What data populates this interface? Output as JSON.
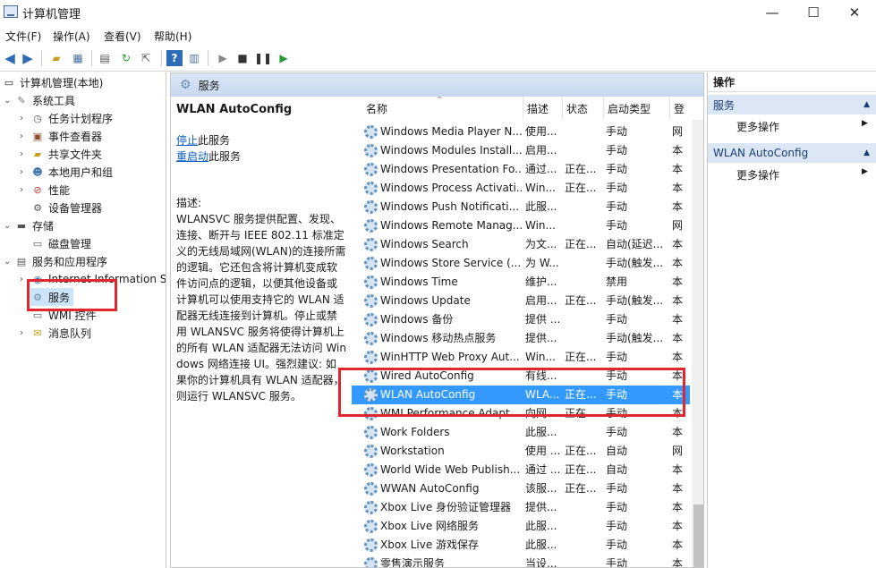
{
  "window": {
    "title": "计算机管理",
    "min": "—",
    "max": "☐",
    "close": "✕"
  },
  "menu": [
    "文件(F)",
    "操作(A)",
    "查看(V)",
    "帮助(H)"
  ],
  "tree": [
    {
      "label": "计算机管理(本地)",
      "icon": "computer-icon"
    },
    {
      "label": "系统工具",
      "icon": "tools-icon"
    },
    {
      "label": "任务计划程序",
      "icon": "clock-icon"
    },
    {
      "label": "事件查看器",
      "icon": "event-viewer-icon"
    },
    {
      "label": "共享文件夹",
      "icon": "shared-folder-icon"
    },
    {
      "label": "本地用户和组",
      "icon": "users-icon"
    },
    {
      "label": "性能",
      "icon": "performance-icon"
    },
    {
      "label": "设备管理器",
      "icon": "device-manager-icon"
    },
    {
      "label": "存储",
      "icon": "storage-icon"
    },
    {
      "label": "磁盘管理",
      "icon": "disk-icon"
    },
    {
      "label": "服务和应用程序",
      "icon": "services-apps-icon"
    },
    {
      "label": "Internet Information S",
      "icon": "iis-icon"
    },
    {
      "label": "服务",
      "icon": "gear-icon"
    },
    {
      "label": "WMI 控件",
      "icon": "wmi-icon"
    },
    {
      "label": "消息队列",
      "icon": "message-queue-icon"
    }
  ],
  "services_header": "服务",
  "detail": {
    "name": "WLAN AutoConfig",
    "stop_link": "停止",
    "stop_suffix": "此服务",
    "restart_link": "重启动",
    "restart_suffix": "此服务",
    "desc_label": "描述:",
    "desc_text": "WLANSVC 服务提供配置、发现、连接、断开与 IEEE 802.11 标准定义的无线局域网(WLAN)的连接所需的逻辑。它还包含将计算机变成软件访问点的逻辑，以便其他设备或计算机可以使用支持它的 WLAN 适配器无线连接到计算机。停止或禁用 WLANSVC 服务将使得计算机上的所有 WLAN 适配器无法访问 Windows 网络连接 UI。强烈建议: 如果你的计算机具有 WLAN 适配器，则运行 WLANSVC 服务。"
  },
  "columns": {
    "name": "名称",
    "desc": "描述",
    "status": "状态",
    "startup": "启动类型",
    "logon": "登"
  },
  "services": [
    {
      "name": "Windows Media Player N...",
      "desc": "使用...",
      "status": "",
      "startup": "手动",
      "logon": "网"
    },
    {
      "name": "Windows Modules Install...",
      "desc": "启用...",
      "status": "",
      "startup": "手动",
      "logon": "本"
    },
    {
      "name": "Windows Presentation Fo...",
      "desc": "通过...",
      "status": "正在...",
      "startup": "手动",
      "logon": "本"
    },
    {
      "name": "Windows Process Activati...",
      "desc": "Win...",
      "status": "正在...",
      "startup": "手动",
      "logon": "本"
    },
    {
      "name": "Windows Push Notificati...",
      "desc": "此服...",
      "status": "",
      "startup": "手动",
      "logon": "本"
    },
    {
      "name": "Windows Remote Manag...",
      "desc": "Win...",
      "status": "",
      "startup": "手动",
      "logon": "网"
    },
    {
      "name": "Windows Search",
      "desc": "为文...",
      "status": "正在...",
      "startup": "自动(延迟...",
      "logon": "本"
    },
    {
      "name": "Windows Store Service (...",
      "desc": "为 W...",
      "status": "",
      "startup": "手动(触发...",
      "logon": "本"
    },
    {
      "name": "Windows Time",
      "desc": "维护...",
      "status": "",
      "startup": "禁用",
      "logon": "本"
    },
    {
      "name": "Windows Update",
      "desc": "启用...",
      "status": "正在...",
      "startup": "手动(触发...",
      "logon": "本"
    },
    {
      "name": "Windows 备份",
      "desc": "提供 ...",
      "status": "",
      "startup": "手动",
      "logon": "本"
    },
    {
      "name": "Windows 移动热点服务",
      "desc": "提供...",
      "status": "",
      "startup": "手动(触发...",
      "logon": "本"
    },
    {
      "name": "WinHTTP Web Proxy Aut...",
      "desc": "Win...",
      "status": "正在...",
      "startup": "手动",
      "logon": "本"
    },
    {
      "name": "Wired AutoConfig",
      "desc": "有线...",
      "status": "",
      "startup": "手动",
      "logon": "本"
    },
    {
      "name": "WLAN AutoConfig",
      "desc": "WLA...",
      "status": "正在...",
      "startup": "手动",
      "logon": "本"
    },
    {
      "name": "WMI Performance Adapt...",
      "desc": "向网...",
      "status": "正在...",
      "startup": "手动",
      "logon": "本"
    },
    {
      "name": "Work Folders",
      "desc": "此服...",
      "status": "",
      "startup": "手动",
      "logon": "本"
    },
    {
      "name": "Workstation",
      "desc": "使用 ...",
      "status": "正在...",
      "startup": "自动",
      "logon": "网"
    },
    {
      "name": "World Wide Web Publish...",
      "desc": "通过 ...",
      "status": "正在...",
      "startup": "自动",
      "logon": "本"
    },
    {
      "name": "WWAN AutoConfig",
      "desc": "该服...",
      "status": "正在...",
      "startup": "手动",
      "logon": "本"
    },
    {
      "name": "Xbox Live 身份验证管理器",
      "desc": "提供...",
      "status": "",
      "startup": "手动",
      "logon": "本"
    },
    {
      "name": "Xbox Live 网络服务",
      "desc": "此服...",
      "status": "",
      "startup": "手动",
      "logon": "本"
    },
    {
      "name": "Xbox Live 游戏保存",
      "desc": "此服...",
      "status": "",
      "startup": "手动",
      "logon": "本"
    },
    {
      "name": "零售演示服务",
      "desc": "当设...",
      "status": "",
      "startup": "手动",
      "logon": "本"
    }
  ],
  "selected_service": "WLAN AutoConfig",
  "actions": {
    "title": "操作",
    "sections": [
      {
        "header": "服务",
        "item": "更多操作"
      },
      {
        "header": "WLAN AutoConfig",
        "item": "更多操作"
      }
    ]
  },
  "colors": {
    "highlight": "#e0262e",
    "selection": "#3399ff",
    "header_bg": "#dbe7f5"
  }
}
